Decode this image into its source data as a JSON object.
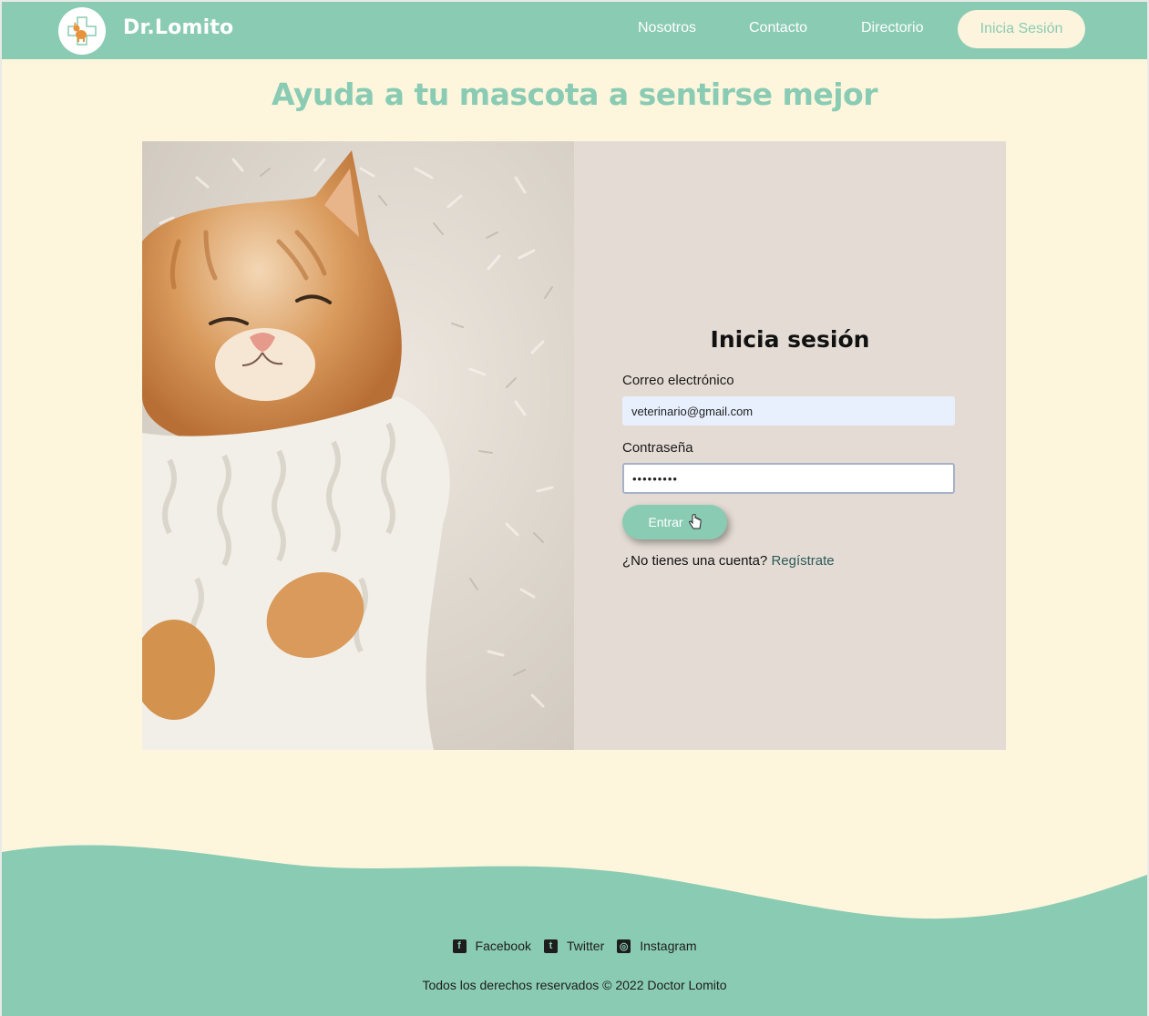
{
  "header": {
    "brand": "Dr.Lomito",
    "nav": [
      "Nosotros",
      "Contacto",
      "Directorio"
    ],
    "login_button": "Inicia Sesión"
  },
  "hero": {
    "title": "Ayuda a tu mascota a sentirse mejor"
  },
  "login": {
    "title": "Inicia sesión",
    "email_label": "Correo electrónico",
    "email_value": "veterinario@gmail.com",
    "password_label": "Contraseña",
    "password_value": "•••••••••",
    "submit_label": "Entrar",
    "no_account_text": "¿No tienes una cuenta?",
    "register_link": "Regístrate"
  },
  "footer": {
    "socials": [
      {
        "label": "Facebook",
        "icon": "facebook-icon"
      },
      {
        "label": "Twitter",
        "icon": "twitter-icon"
      },
      {
        "label": "Instagram",
        "icon": "instagram-icon"
      }
    ],
    "copyright": "Todos los derechos reservados © 2022 Doctor Lomito"
  },
  "colors": {
    "primary": "#8acbb4",
    "background": "#fdf6dc",
    "card": "#e4dcd4"
  }
}
